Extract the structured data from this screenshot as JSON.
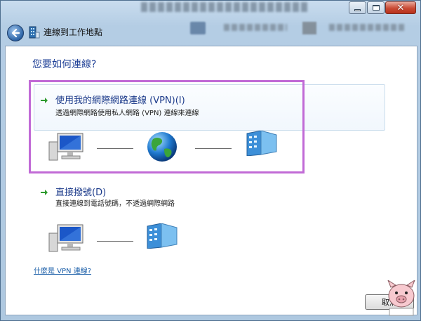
{
  "window": {
    "title": "連線到工作地點",
    "controls": {
      "minimize": "minimize-icon",
      "maximize": "maximize-icon",
      "close": "close-icon"
    }
  },
  "header": {
    "back_icon": "back-arrow-icon"
  },
  "main": {
    "heading": "您要如何連線?",
    "options": [
      {
        "title": "使用我的網際網路連線 (VPN)(I)",
        "description": "透過網際網路使用私人網路 (VPN) 連線來連線",
        "diagram": [
          "computer-icon",
          "internet-globe-icon",
          "workplace-server-icon"
        ]
      },
      {
        "title": "直接撥號(D)",
        "description": "直接連線到電話號碼，不透過網際網路",
        "diagram": [
          "computer-icon",
          "workplace-server-icon"
        ]
      }
    ],
    "help_link": "什麼是 VPN 連線?"
  },
  "footer": {
    "cancel_label": "取消"
  },
  "colors": {
    "highlight_border": "#c16ad6",
    "heading_text": "#1e3f96",
    "link_text": "#1a5ea8",
    "accent_arrow": "#2e9a2e"
  }
}
